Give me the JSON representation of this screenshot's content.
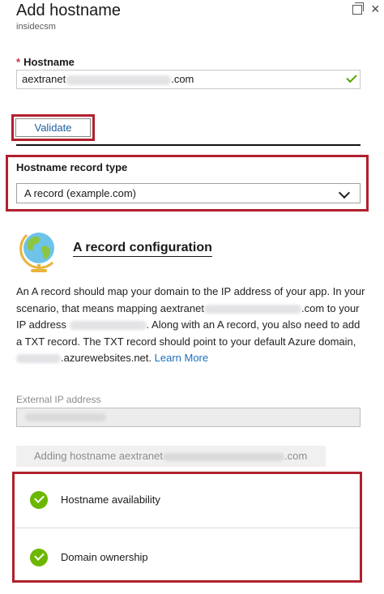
{
  "header": {
    "title": "Add hostname",
    "subtitle": "insidecsm"
  },
  "hostname": {
    "required_mark": "*",
    "label": "Hostname",
    "value_prefix": "aextranet",
    "value_suffix": ".com"
  },
  "validate_label": "Validate",
  "record_type": {
    "label": "Hostname record type",
    "selected": "A record (example.com)"
  },
  "config": {
    "title": "A record configuration",
    "desc_1": "An A record should map your domain to the IP address of your app. In your scenario, that means mapping",
    "desc_2": "aextranet",
    "desc_3": ".com to your IP address",
    "desc_4": ". Along with an A record, you also need to add a TXT record. The TXT record should point to your default Azure domain,",
    "desc_5": ".azurewebsites.net.",
    "learn_more": "Learn More"
  },
  "external_ip": {
    "label": "External IP address"
  },
  "adding": {
    "prefix": "Adding hostname aextranet",
    "suffix": ".com"
  },
  "checks": [
    {
      "label": "Hostname availability"
    },
    {
      "label": "Domain ownership"
    }
  ],
  "colors": {
    "accent_red": "#b0202d",
    "success_green": "#6bb700",
    "link_blue": "#1d6eb8"
  }
}
